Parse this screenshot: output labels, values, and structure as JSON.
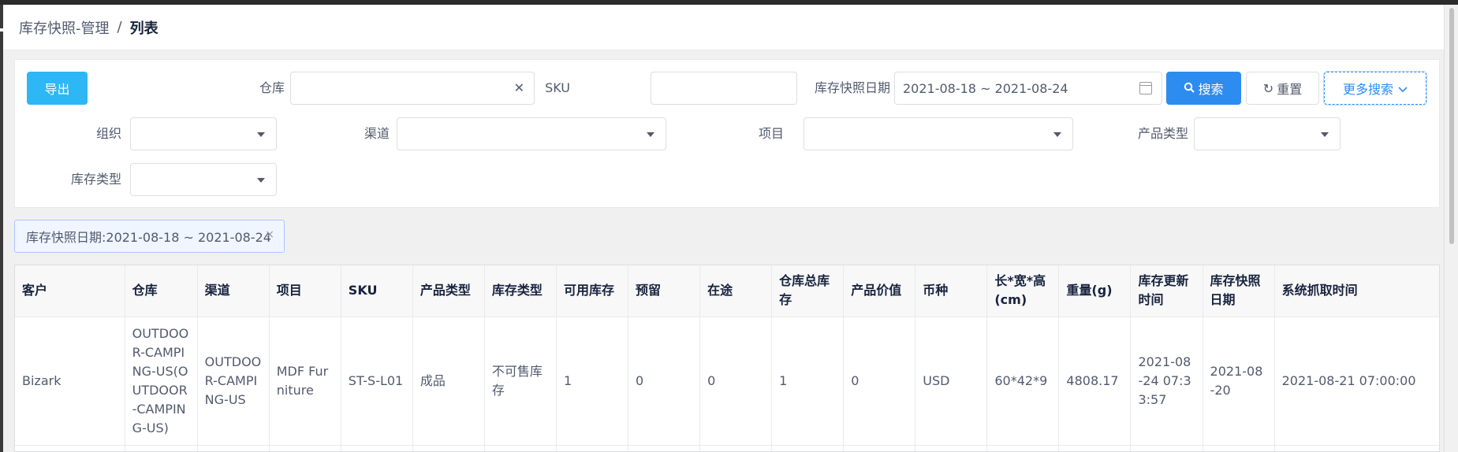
{
  "breadcrumb": {
    "parent": "库存快照-管理",
    "separator": "/",
    "current": "列表"
  },
  "toolbar": {
    "export_label": "导出",
    "search_label": "搜索",
    "reset_label": "重置",
    "more_label": "更多搜索"
  },
  "filters": {
    "warehouse": {
      "label": "仓库",
      "value": ""
    },
    "sku": {
      "label": "SKU",
      "value": ""
    },
    "snapshot_date": {
      "label": "库存快照日期",
      "value": "2021-08-18 ~ 2021-08-24"
    },
    "org": {
      "label": "组织",
      "value": ""
    },
    "channel": {
      "label": "渠道",
      "value": ""
    },
    "project": {
      "label": "项目",
      "value": ""
    },
    "product_type": {
      "label": "产品类型",
      "value": ""
    },
    "stock_type": {
      "label": "库存类型",
      "value": ""
    }
  },
  "active_tag": {
    "text": "库存快照日期:2021-08-18 ~ 2021-08-24",
    "close": "×"
  },
  "table": {
    "columns": [
      "客户",
      "仓库",
      "渠道",
      "项目",
      "SKU",
      "产品类型",
      "库存类型",
      "可用库存",
      "预留",
      "在途",
      "仓库总库存",
      "产品价值",
      "币种",
      "长*宽*高(cm)",
      "重量(g)",
      "库存更新时间",
      "库存快照日期",
      "系统抓取时间"
    ],
    "rows": [
      [
        "Bizark",
        "OUTDOOR-CAMPING-US(OUTDOOR-CAMPING-US)",
        "OUTDOOR-CAMPING-US",
        "MDF Furniture",
        "ST-S-L01",
        "成品",
        "不可售库存",
        "1",
        "0",
        "0",
        "1",
        "0",
        "USD",
        "60*42*9",
        "4808.17",
        "2021-08-24 07:33:57",
        "2021-08-20",
        "2021-08-21 07:00:00"
      ]
    ]
  },
  "colors": {
    "export": "#2db7f5",
    "primary": "#2d8cf0"
  },
  "icons": {
    "clear": "close-icon",
    "calendar": "calendar-icon",
    "search": "search-icon",
    "reset": "refresh-icon",
    "more": "chevron-down-icon",
    "dropdown": "caret-down-icon"
  }
}
